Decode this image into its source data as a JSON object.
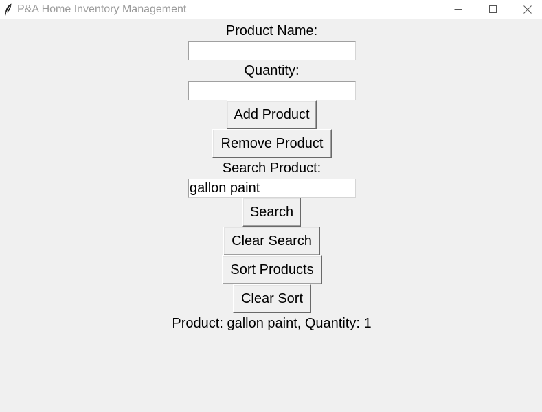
{
  "window": {
    "title": "P&A Home Inventory Management",
    "icon": "feather-icon"
  },
  "form": {
    "product_name_label": "Product Name:",
    "product_name_value": "",
    "quantity_label": "Quantity:",
    "quantity_value": "",
    "add_label": "Add Product",
    "remove_label": "Remove Product",
    "search_label": "Search Product:",
    "search_value": "gallon paint",
    "search_button_label": "Search",
    "clear_search_label": "Clear Search",
    "sort_label": "Sort Products",
    "clear_sort_label": "Clear Sort"
  },
  "result": {
    "text": "Product: gallon paint, Quantity: 1"
  }
}
